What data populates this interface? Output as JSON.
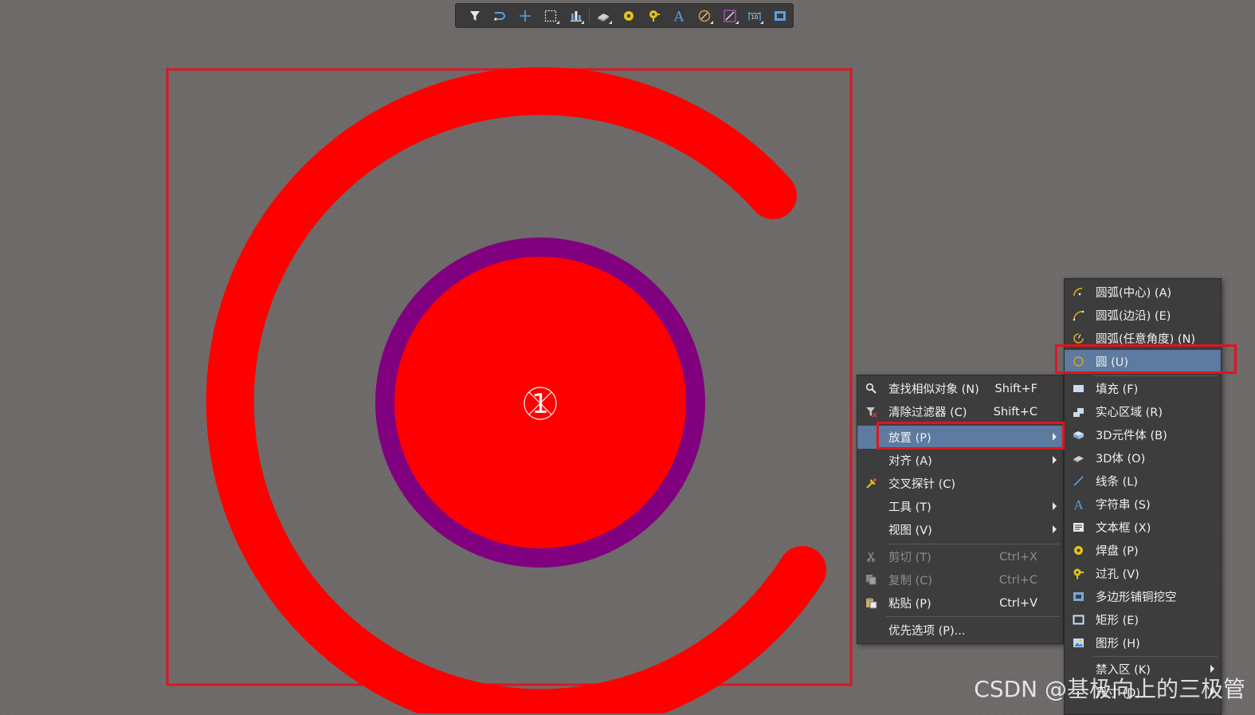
{
  "canvas": {
    "background": "#6e6a69",
    "pad_designator": "1",
    "colors": {
      "top_layer": "#ff0000",
      "solder_mask": "#800080",
      "selection_box": "#e0141e"
    }
  },
  "toolbar": {
    "buttons": [
      {
        "icon": "filter-icon"
      },
      {
        "icon": "route-icon"
      },
      {
        "icon": "crosshair-add-icon"
      },
      {
        "icon": "select-rect-icon"
      },
      {
        "icon": "align-bars-icon"
      },
      {
        "icon": "3d-body-icon"
      },
      {
        "icon": "pad-icon"
      },
      {
        "icon": "via-icon"
      },
      {
        "icon": "string-text-icon",
        "glyph": "A"
      },
      {
        "icon": "arc-icon"
      },
      {
        "icon": "line-icon"
      },
      {
        "icon": "dimension-icon"
      },
      {
        "icon": "rectangle-icon"
      }
    ]
  },
  "context_menu": {
    "items": [
      {
        "label": "查找相似对象 (N)",
        "shortcut": "Shift+F",
        "icon": "find-similar-icon"
      },
      {
        "label": "清除过滤器 (C)",
        "shortcut": "Shift+C",
        "icon": "clear-filter-icon"
      },
      {
        "label": "放置 (P)",
        "shortcut": "",
        "icon": "",
        "highlighted": true,
        "submenu": true
      },
      {
        "label": "对齐 (A)",
        "shortcut": "",
        "icon": "",
        "submenu": true
      },
      {
        "label": "交叉探针 (C)",
        "shortcut": "",
        "icon": "cross-probe-icon"
      },
      {
        "label": "工具 (T)",
        "shortcut": "",
        "icon": "",
        "submenu": true
      },
      {
        "label": "视图 (V)",
        "shortcut": "",
        "icon": "",
        "submenu": true
      },
      {
        "label": "剪切 (T)",
        "shortcut": "Ctrl+X",
        "icon": "cut-icon",
        "disabled": true
      },
      {
        "label": "复制 (C)",
        "shortcut": "Ctrl+C",
        "icon": "copy-icon",
        "disabled": true
      },
      {
        "label": "粘贴 (P)",
        "shortcut": "Ctrl+V",
        "icon": "paste-icon"
      },
      {
        "label": "优先选项 (P)...",
        "shortcut": "",
        "icon": ""
      }
    ]
  },
  "place_submenu": {
    "items": [
      {
        "label": "圆弧(中心) (A)",
        "icon": "arc-center-icon"
      },
      {
        "label": "圆弧(边沿) (E)",
        "icon": "arc-edge-icon"
      },
      {
        "label": "圆弧(任意角度) (N)",
        "icon": "arc-any-angle-icon"
      },
      {
        "label": "圆 (U)",
        "icon": "circle-icon",
        "highlighted": true
      },
      {
        "label": "填充 (F)",
        "icon": "fill-icon"
      },
      {
        "label": "实心区域 (R)",
        "icon": "solid-region-icon"
      },
      {
        "label": "3D元件体 (B)",
        "icon": "3d-component-body-icon"
      },
      {
        "label": "3D体 (O)",
        "icon": "3d-body-icon"
      },
      {
        "label": "线条 (L)",
        "icon": "line-icon"
      },
      {
        "label": "字符串 (S)",
        "icon": "string-icon"
      },
      {
        "label": "文本框 (X)",
        "icon": "text-frame-icon"
      },
      {
        "label": "焊盘 (P)",
        "icon": "pad-icon"
      },
      {
        "label": "过孔 (V)",
        "icon": "via-icon"
      },
      {
        "label": "多边形铺铜挖空",
        "icon": "polygon-cutout-icon"
      },
      {
        "label": "矩形 (E)",
        "icon": "rectangle-icon"
      },
      {
        "label": "图形 (H)",
        "icon": "graphic-icon"
      },
      {
        "label": "禁入区 (K)",
        "icon": "",
        "submenu": true
      },
      {
        "label": "尺寸 (D)",
        "icon": "",
        "submenu": true
      }
    ]
  },
  "watermark": "CSDN @基极向上的三极管"
}
